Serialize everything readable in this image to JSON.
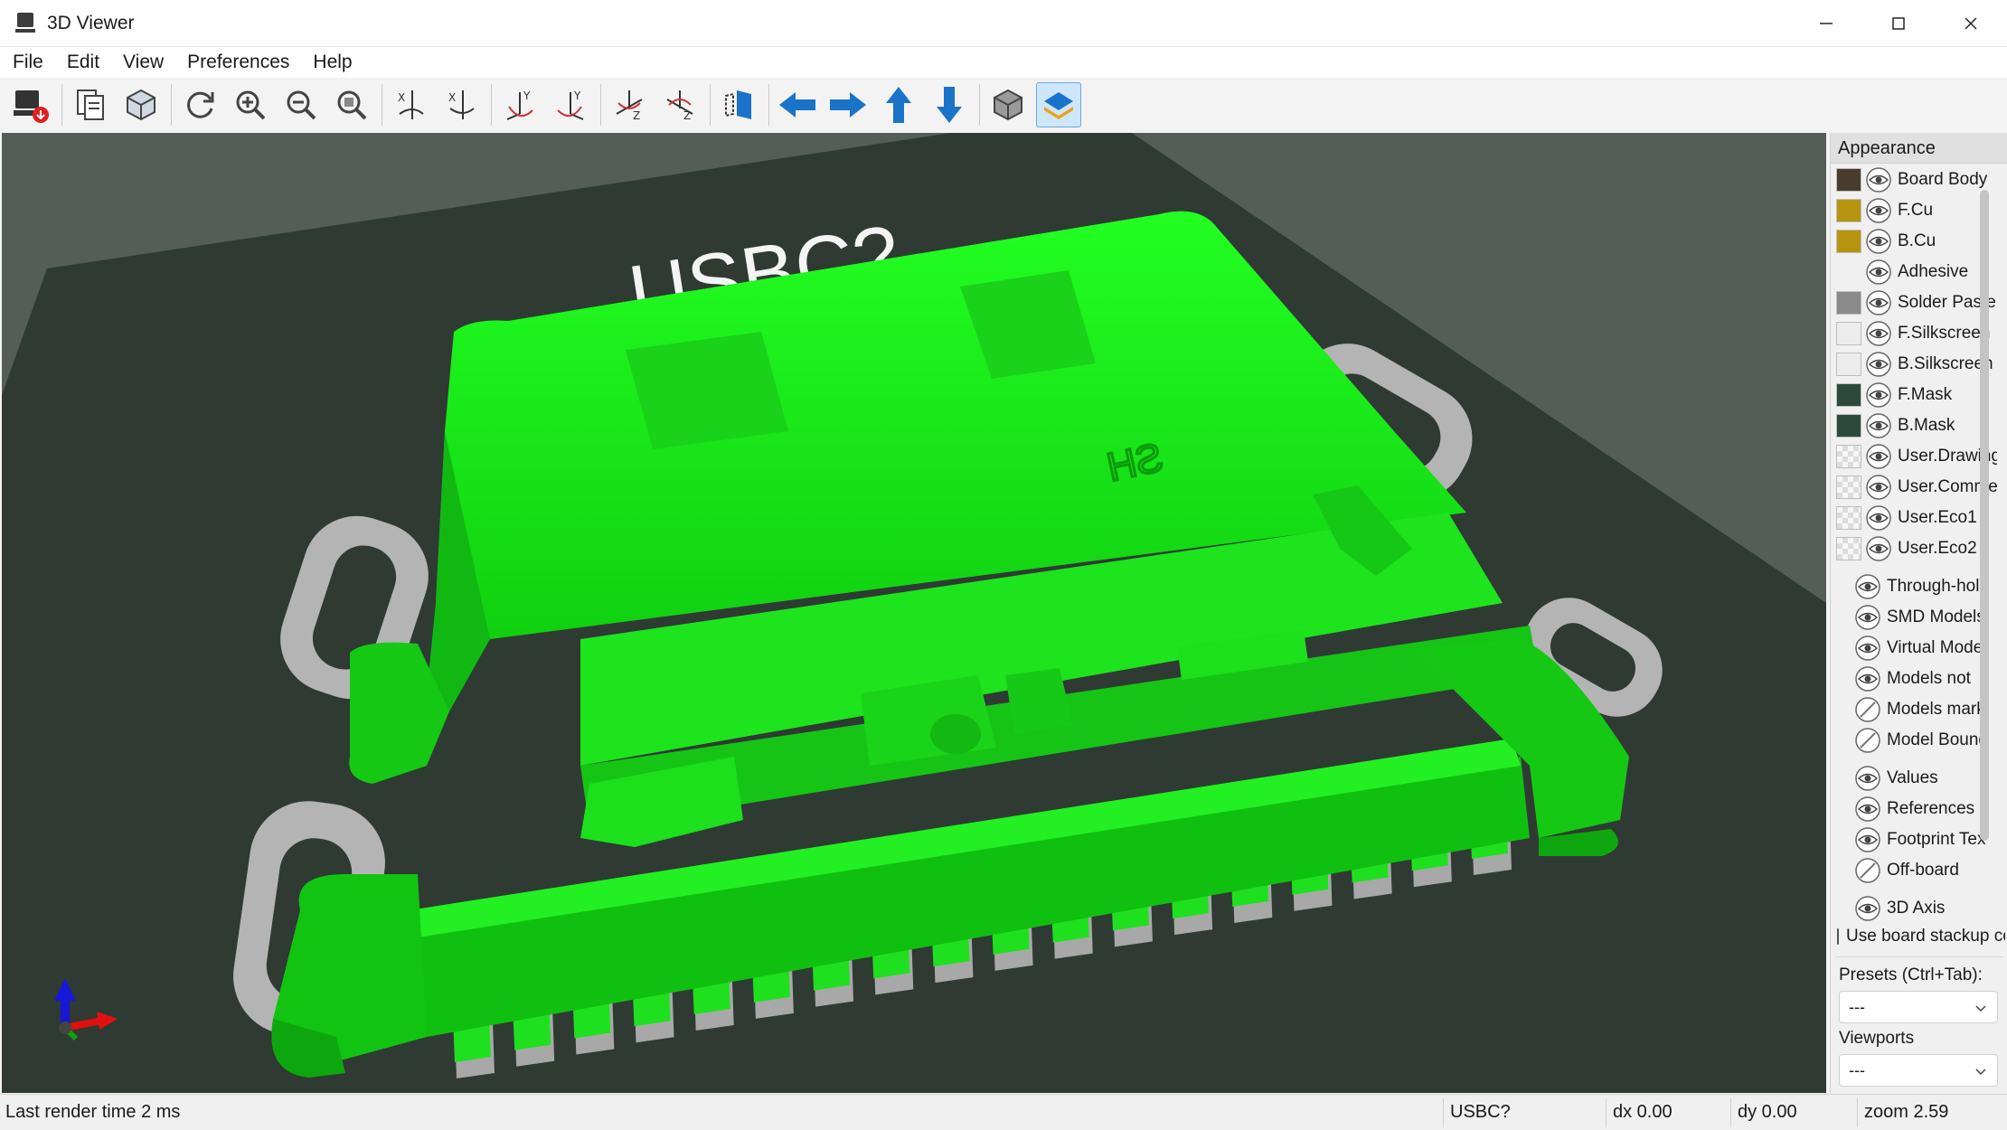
{
  "window": {
    "title": "3D Viewer",
    "controls": [
      "minimize-icon",
      "maximize-icon",
      "close-icon"
    ]
  },
  "menu": [
    "File",
    "Edit",
    "View",
    "Preferences",
    "Help"
  ],
  "toolbar": {
    "buttons": [
      {
        "name": "render-export-icon"
      },
      {
        "name": "copy-image-icon"
      },
      {
        "name": "render-options-icon"
      },
      {
        "name": "reload-icon"
      },
      {
        "name": "zoom-in-icon"
      },
      {
        "name": "zoom-out-icon"
      },
      {
        "name": "zoom-fit-icon"
      },
      {
        "name": "rotate-x-cw-icon"
      },
      {
        "name": "rotate-x-ccw-icon"
      },
      {
        "name": "rotate-y-cw-icon"
      },
      {
        "name": "rotate-y-ccw-icon"
      },
      {
        "name": "rotate-z-cw-icon"
      },
      {
        "name": "rotate-z-ccw-icon"
      },
      {
        "name": "flip-board-icon"
      },
      {
        "name": "move-left-icon"
      },
      {
        "name": "move-right-icon"
      },
      {
        "name": "move-up-icon"
      },
      {
        "name": "move-down-icon"
      },
      {
        "name": "orthographic-icon"
      },
      {
        "name": "layers-manager-icon",
        "active": true
      }
    ]
  },
  "viewport": {
    "board_text": "USBC?",
    "model_marking": "SH",
    "colors": {
      "background": "#555d56",
      "board": "#2f3a33",
      "pad": "#9a9a9a",
      "model": "#1fe01f"
    }
  },
  "appearance": {
    "title": "Appearance",
    "layers": [
      {
        "label": "Board Body",
        "swatch": "#4a3c2c",
        "visibility": "eye-icon"
      },
      {
        "label": "F.Cu",
        "swatch": "#b5950f",
        "visibility": "eye-icon"
      },
      {
        "label": "B.Cu",
        "swatch": "#b5950f",
        "visibility": "eye-icon"
      },
      {
        "label": "Adhesive",
        "swatch": "none",
        "visibility": "eye-icon"
      },
      {
        "label": "Solder Paste",
        "swatch": "#8a8a8a",
        "visibility": "eye-icon"
      },
      {
        "label": "F.Silkscreen",
        "swatch": "#ececec",
        "visibility": "eye-icon"
      },
      {
        "label": "B.Silkscreen",
        "swatch": "#ececec",
        "visibility": "eye-icon"
      },
      {
        "label": "F.Mask",
        "swatch": "#2c4a3c",
        "visibility": "eye-icon"
      },
      {
        "label": "B.Mask",
        "swatch": "#2c4a3c",
        "visibility": "eye-icon"
      },
      {
        "label": "User.Drawings",
        "swatch": "checker",
        "visibility": "eye-icon"
      },
      {
        "label": "User.Comments",
        "swatch": "checker",
        "visibility": "eye-icon"
      },
      {
        "label": "User.Eco1",
        "swatch": "checker",
        "visibility": "eye-icon"
      },
      {
        "label": "User.Eco2",
        "swatch": "checker",
        "visibility": "eye-icon"
      }
    ],
    "models": [
      {
        "label": "Through-hole",
        "visibility": "eye-icon"
      },
      {
        "label": "SMD Models",
        "visibility": "eye-icon"
      },
      {
        "label": "Virtual Models",
        "visibility": "eye-icon"
      },
      {
        "label": "Models not",
        "visibility": "eye-icon"
      },
      {
        "label": "Models marked",
        "visibility": "eye-off-icon"
      },
      {
        "label": "Model Bounding",
        "visibility": "eye-off-icon"
      }
    ],
    "other": [
      {
        "label": "Values",
        "visibility": "eye-icon"
      },
      {
        "label": "References",
        "visibility": "eye-icon"
      },
      {
        "label": "Footprint Text",
        "visibility": "eye-icon"
      },
      {
        "label": "Off-board",
        "visibility": "eye-off-icon"
      }
    ],
    "axis": {
      "label": "3D Axis",
      "visibility": "eye-icon"
    },
    "use_board_stackup": {
      "label": "Use board stackup colors",
      "checked": false
    },
    "presets": {
      "label": "Presets (Ctrl+Tab):",
      "value": "---"
    },
    "viewports": {
      "label": "Viewports",
      "value": "---"
    }
  },
  "status": {
    "render_time": "Last render time 2 ms",
    "item": "USBC?",
    "dx": "dx 0.00",
    "dy": "dy 0.00",
    "zoom": "zoom 2.59"
  }
}
